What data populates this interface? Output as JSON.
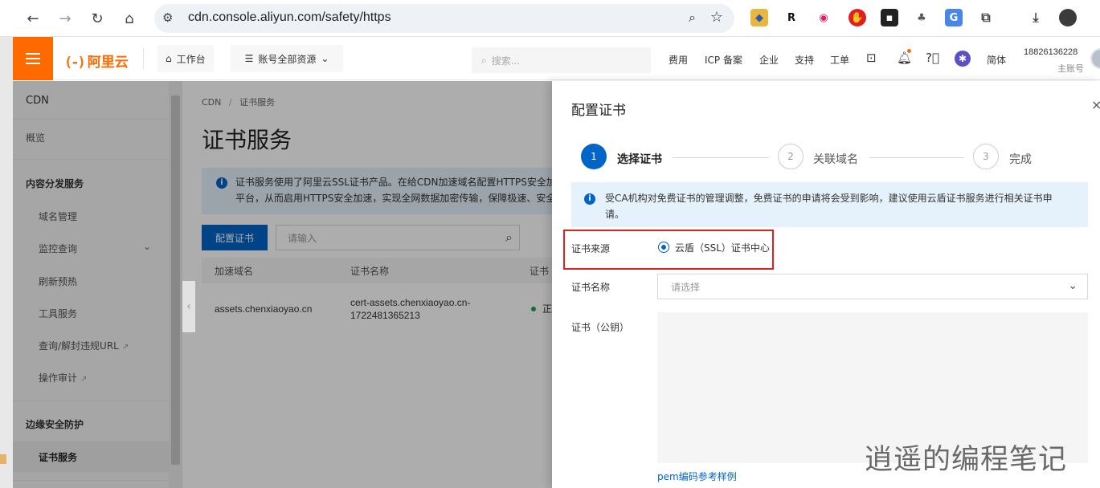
{
  "browser": {
    "url": "cdn.console.aliyun.com/safety/https"
  },
  "header": {
    "logo_text": "阿里云",
    "workbench": "工作台",
    "resources": "账号全部资源",
    "search_placeholder": "搜索...",
    "nav": [
      "费用",
      "ICP 备案",
      "企业",
      "支持",
      "工单"
    ],
    "lang": "简体",
    "user_id": "18826136228",
    "user_role": "主账号"
  },
  "sidebar": {
    "title": "CDN",
    "overview": "概览",
    "group1": "内容分发服务",
    "items": [
      "域名管理",
      "监控查询",
      "刷新预热",
      "工具服务",
      "查询/解封违规URL",
      "操作审计"
    ],
    "group2": "边缘安全防护",
    "active_item": "证书服务"
  },
  "main": {
    "breadcrumb_root": "CDN",
    "breadcrumb_sep": "/",
    "breadcrumb_current": "证书服务",
    "title": "证书服务",
    "notice_line1": "证书服务使用了阿里云SSL证书产品。在给CDN加速域名配置HTTPS安全加",
    "notice_line2": "平台，从而启用HTTPS安全加速，实现全网数据加密传输，保障极速、安全",
    "config_button": "配置证书",
    "search_placeholder": "请输入",
    "columns": [
      "加速域名",
      "证书名称",
      "证书"
    ],
    "rows": [
      {
        "domain": "assets.chenxiaoyao.cn",
        "cert_line1": "cert-assets.chenxiaoyao.cn-",
        "cert_line2": "1722481365213",
        "status": "正"
      }
    ]
  },
  "drawer": {
    "title": "配置证书",
    "close": "×",
    "steps": [
      {
        "num": "1",
        "label": "选择证书"
      },
      {
        "num": "2",
        "label": "关联域名"
      },
      {
        "num": "3",
        "label": "完成"
      }
    ],
    "notice_line1": "受CA机构对免费证书的管理调整，免费证书的申请将会受到影响，建议使用云盾证书服务进行相关证书申",
    "notice_line2": "请。",
    "source_label": "证书来源",
    "source_option": "云盾（SSL）证书中心",
    "name_label": "证书名称",
    "name_placeholder": "请选择",
    "public_key_label": "证书（公钥）",
    "pem_link": "pem编码参考样例"
  },
  "watermark": "逍遥的编程笔记",
  "colors": {
    "brand_orange": "#ff6a00",
    "primary_blue": "#0064c8",
    "highlight_red": "#e02020"
  }
}
